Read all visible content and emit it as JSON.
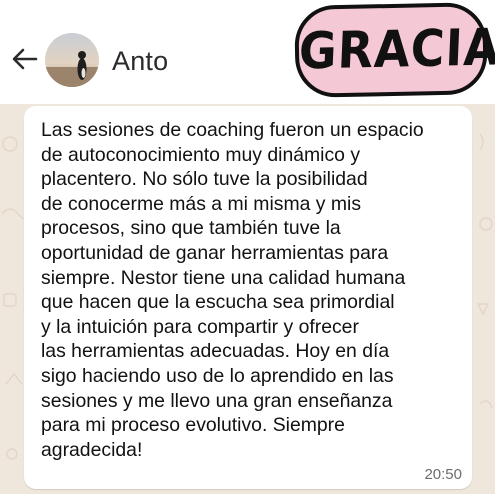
{
  "header": {
    "back_icon": "arrow-left-icon",
    "contact_name": "Anto"
  },
  "sticker": {
    "text": "GRACIAS",
    "color": "#f4c8d4"
  },
  "message": {
    "text": "Las sesiones de coaching fueron un espacio\nde autoconocimiento muy dinámico y\nplacentero. No sólo tuve la posibilidad\nde conocerme más a mi misma y mis\nprocesos, sino que también tuve la\noportunidad de ganar herramientas para\nsiempre. Nestor tiene una calidad humana\nque hacen que la escucha sea primordial\ny la intuición para compartir y ofrecer\nlas herramientas adecuadas. Hoy en día\nsigo haciendo uso de lo aprendido en las\nsesiones y me llevo una gran enseñanza\npara mi proceso evolutivo. Siempre\nagradecida!",
    "time": "20:50"
  }
}
